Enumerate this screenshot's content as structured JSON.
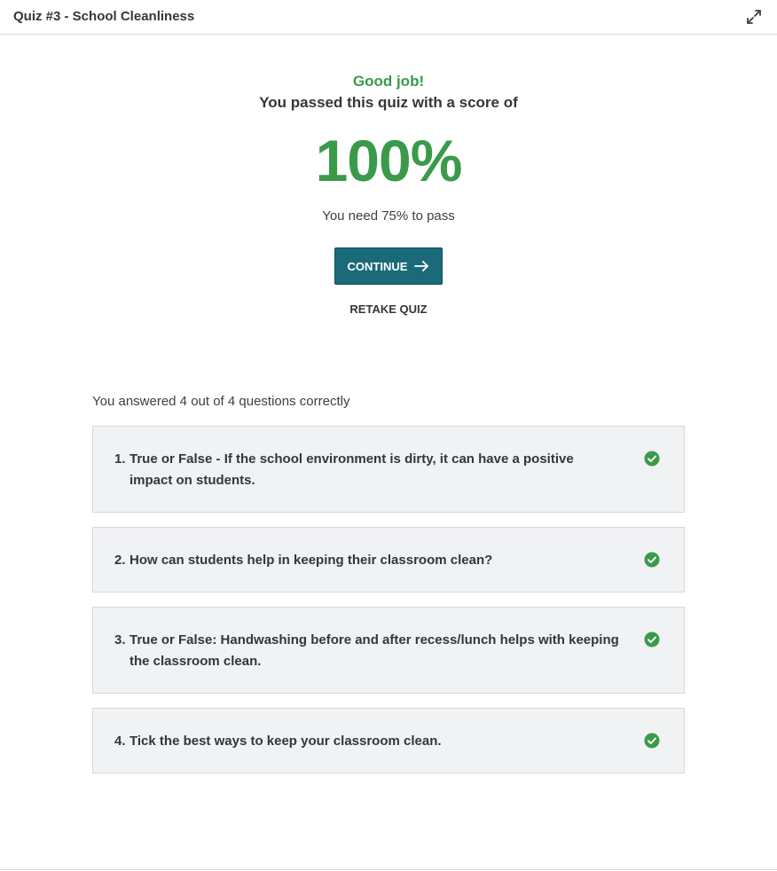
{
  "header": {
    "title": "Quiz #3 - School Cleanliness",
    "expand_icon": "expand-icon"
  },
  "result": {
    "headline": "Good job!",
    "subheadline": "You passed this quiz with a score of",
    "score": "100%",
    "pass_requirement": "You need 75% to pass",
    "continue_label": "CONTINUE",
    "retake_label": "RETAKE QUIZ"
  },
  "summary": {
    "text": "You answered 4 out of 4 questions correctly"
  },
  "questions": [
    {
      "number": "1.",
      "text": "True or False - If the school environment is dirty, it can have a positive impact on students.",
      "status": "correct"
    },
    {
      "number": "2.",
      "text": "How can students help in keeping their classroom clean?",
      "status": "correct"
    },
    {
      "number": "3.",
      "text": "True or False: Handwashing before and after recess/lunch helps with keeping the classroom clean.",
      "status": "correct"
    },
    {
      "number": "4.",
      "text": "Tick the best ways to keep your classroom clean.",
      "status": "correct"
    }
  ],
  "colors": {
    "success": "#3a9a4a",
    "primary_button": "#1b6a7a",
    "card_background": "#f1f2f4"
  }
}
